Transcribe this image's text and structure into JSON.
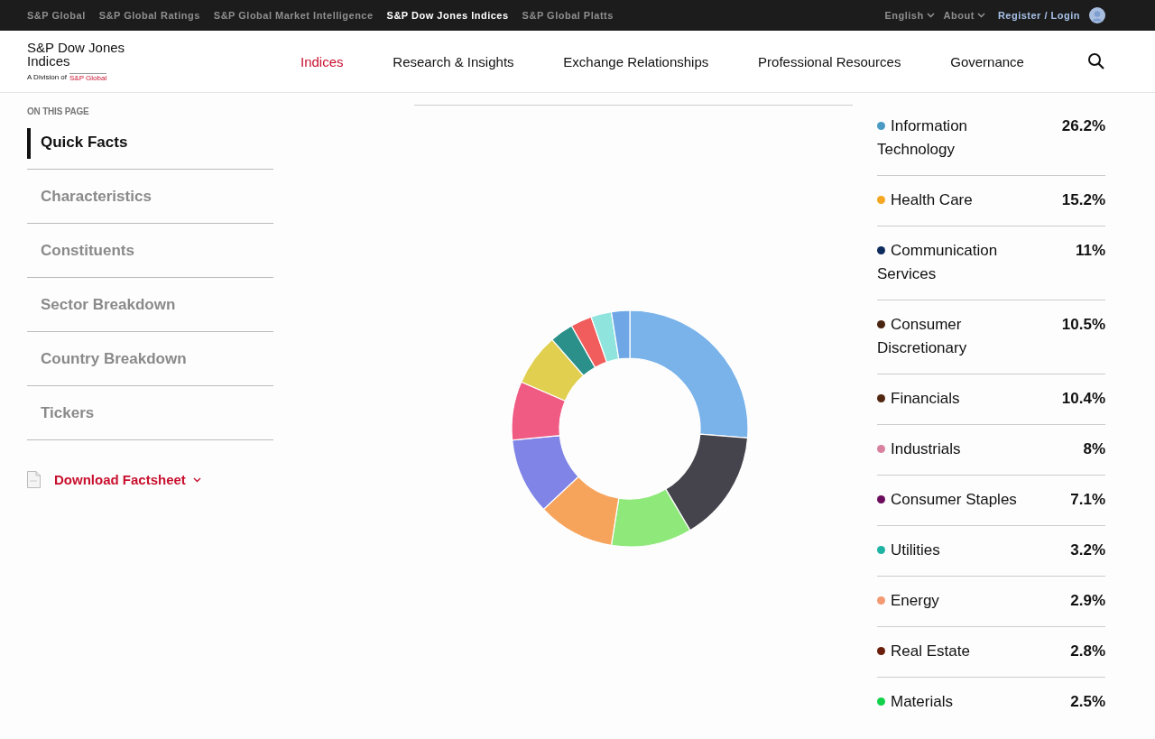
{
  "top_bar": {
    "sites": [
      {
        "label": "S&P Global",
        "selected": false
      },
      {
        "label": "S&P Global Ratings",
        "selected": false
      },
      {
        "label": "S&P Global Market Intelligence",
        "selected": false
      },
      {
        "label": "S&P Dow Jones Indices",
        "selected": true
      },
      {
        "label": "S&P Global Platts",
        "selected": false
      }
    ],
    "menus": [
      "English",
      "About"
    ],
    "login": "Register / Login"
  },
  "header": {
    "logo": {
      "name": "S&P Dow Jones Indices",
      "division": "A Division of",
      "parent": "S&P Global"
    },
    "nav": [
      {
        "label": "Indices",
        "selected": true
      },
      {
        "label": "Research & Insights",
        "selected": false
      },
      {
        "label": "Exchange Relationships",
        "selected": false
      },
      {
        "label": "Professional Resources",
        "selected": false
      },
      {
        "label": "Governance",
        "selected": false
      }
    ]
  },
  "sidebar": {
    "heading": "ON THIS PAGE",
    "items": [
      {
        "label": "Quick Facts",
        "selected": true
      },
      {
        "label": "Characteristics",
        "selected": false
      },
      {
        "label": "Constituents",
        "selected": false
      },
      {
        "label": "Sector Breakdown",
        "selected": false
      },
      {
        "label": "Country Breakdown",
        "selected": false
      },
      {
        "label": "Tickers",
        "selected": false
      }
    ],
    "download": {
      "label": "Download Factsheet"
    }
  },
  "sector_breakdown": {
    "chart_data": {
      "type": "donut",
      "categories": [
        "Information Technology",
        "Health Care",
        "Communication Services",
        "Consumer Discretionary",
        "Financials",
        "Industrials",
        "Consumer Staples",
        "Utilities",
        "Energy",
        "Real Estate",
        "Materials"
      ],
      "values": [
        26.2,
        15.2,
        11,
        10.5,
        10.4,
        8,
        7.1,
        3.2,
        2.9,
        2.8,
        2.5
      ]
    },
    "legend": [
      {
        "value": "26.2%",
        "color": "#4a9bc4"
      },
      {
        "value": "15.2%",
        "color": "#f5a623"
      },
      {
        "value": "11%",
        "color": "#0d2b5c"
      },
      {
        "value": "10.5%",
        "color": "#4a2511"
      },
      {
        "value": "10.4%",
        "color": "#51270f"
      },
      {
        "value": "8%",
        "color": "#d9829f"
      },
      {
        "value": "7.1%",
        "color": "#6b0d5c"
      },
      {
        "value": "3.2%",
        "color": "#1fb3a3"
      },
      {
        "value": "2.9%",
        "color": "#f39a72"
      },
      {
        "value": "2.8%",
        "color": "#6b1e0c"
      },
      {
        "value": "2.5%",
        "color": "#13d14b"
      }
    ]
  }
}
